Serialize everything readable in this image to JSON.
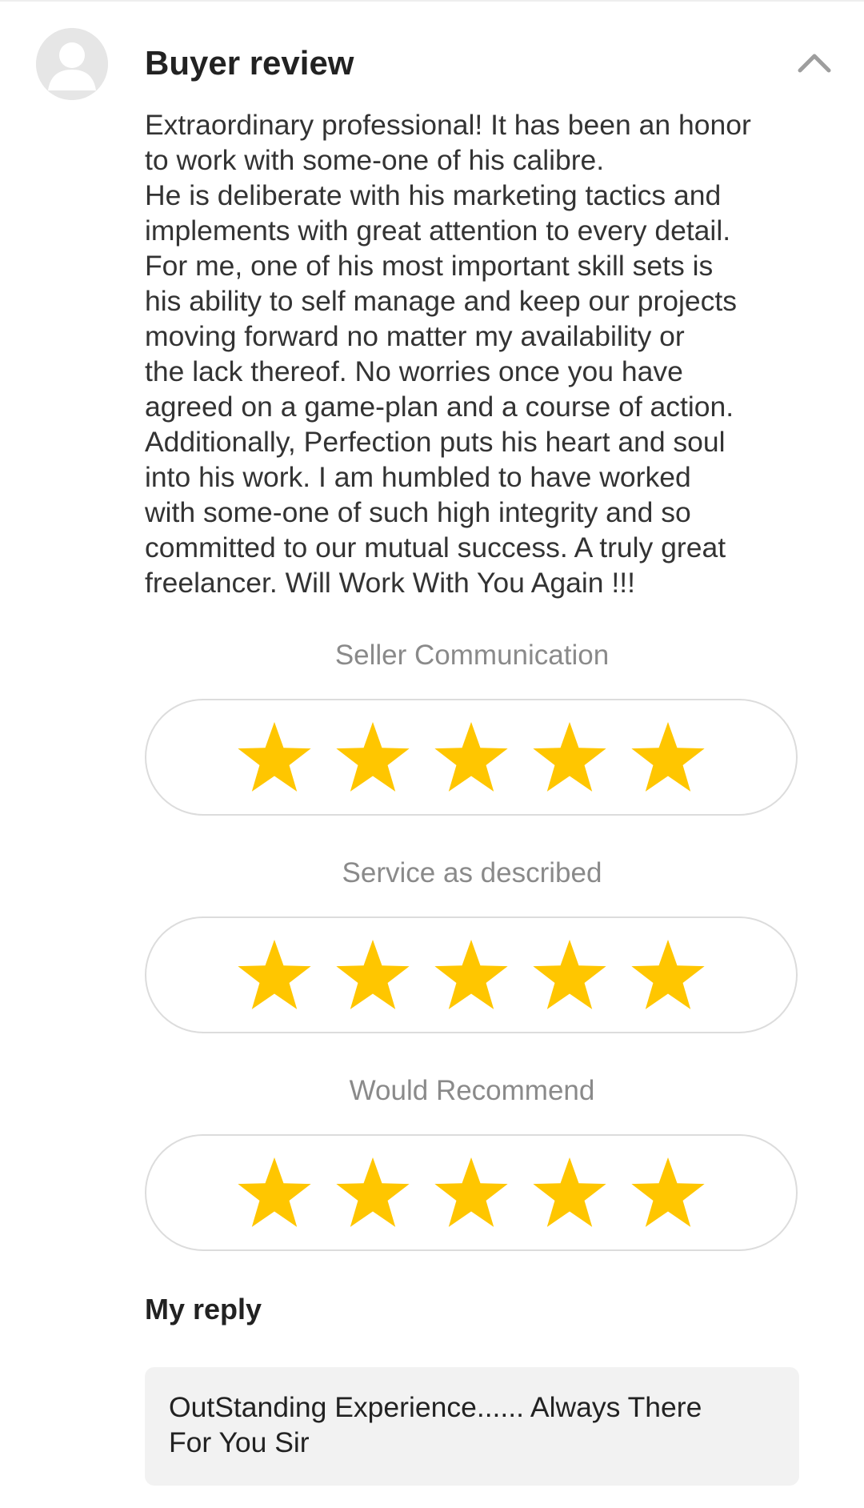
{
  "header": {
    "title": "Buyer review",
    "avatar_icon": "user-avatar-icon",
    "collapse_icon": "chevron-up-icon"
  },
  "review": {
    "text": "Extraordinary professional! It has been an honor\nto work with some-one of his calibre.\nHe is deliberate with his marketing tactics and\nimplements with great attention to every detail.\nFor me, one of his most important skill sets is\nhis ability to self manage and keep our projects\nmoving forward no matter my availability or\nthe lack thereof. No worries once you have\nagreed on a game-plan and a course of action.\nAdditionally, Perfection puts his heart and soul\ninto his work. I am humbled to have worked\nwith some-one of such high integrity and so\ncommitted to our mutual success. A truly great\nfreelancer. Will Work With You Again !!!"
  },
  "ratings": [
    {
      "label": "Seller Communication",
      "stars": 5,
      "max": 5
    },
    {
      "label": "Service as described",
      "stars": 5,
      "max": 5
    },
    {
      "label": "Would Recommend",
      "stars": 5,
      "max": 5
    }
  ],
  "reply": {
    "heading": "My reply",
    "text": "OutStanding Experience...... Always There\nFor You Sir"
  },
  "colors": {
    "star": "#FFC600",
    "pill_border": "#dcdcdc",
    "label": "#8a8a8a",
    "reply_bg": "#f2f2f2"
  }
}
